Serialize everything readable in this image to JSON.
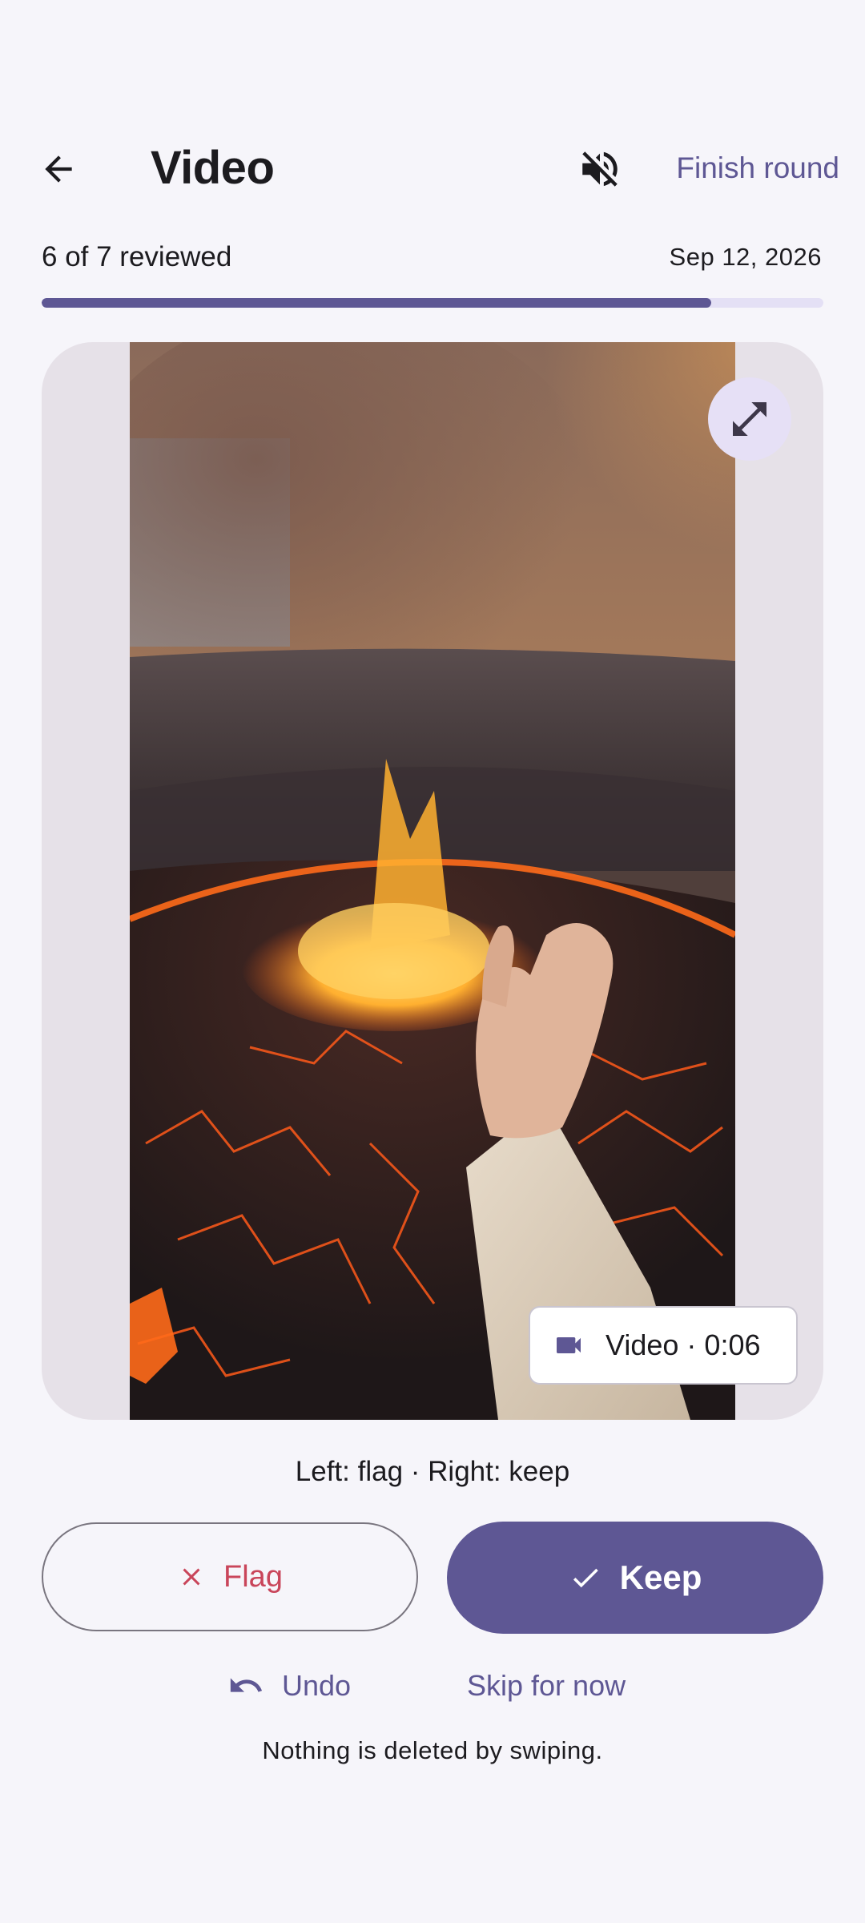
{
  "header": {
    "title": "Video",
    "back_icon": "arrow-left-icon",
    "mute_icon": "volume-off-icon",
    "finish_label": "Finish round"
  },
  "progress": {
    "label": "6 of 7 reviewed",
    "date": "Sep 12, 2026",
    "reviewed": 6,
    "total": 7,
    "fraction": 0.857
  },
  "media": {
    "expand_icon": "expand-icon",
    "chip_icon": "videocam-icon",
    "chip_label": "Video · 0:06"
  },
  "hint": "Left: flag · Right: keep",
  "actions": {
    "flag_label": "Flag",
    "flag_icon": "close-icon",
    "keep_label": "Keep",
    "keep_icon": "check-icon",
    "undo_label": "Undo",
    "undo_icon": "undo-icon",
    "skip_label": "Skip for now"
  },
  "footnote": "Nothing is deleted by swiping.",
  "colors": {
    "accent": "#5e5794",
    "flag": "#c9455a",
    "background": "#f6f5fa",
    "track": "#e4e0f5"
  }
}
